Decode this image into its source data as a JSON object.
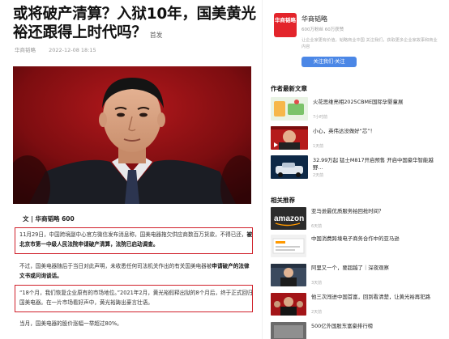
{
  "article": {
    "title": "或将破产清算？入狱10年，国美黄光裕还跟得上时代吗？",
    "title_tail": "首发",
    "author": "华商韬略",
    "date": "2022-12-08 18:15",
    "views": "阅读",
    "byline": "文 | 华商韬略 600",
    "p1_a": "11月29日，中国跨境副中心官方微信发布消息称，国美电器拖欠供应商数百万货款，不得已还，",
    "p1_b": "被北京市第一中级人民法院申请破产清算，法院已启动调查。",
    "p2_a": "不过，国美电器随后于当日对此声明，未收悉任何司法机关作出的有关国美电器被",
    "p2_b": "申请破产的法律文书或问询谈话。",
    "p3": "“18个月，我们恢复企业原有的市场地位。”2021年2月，黄光裕假释出狱的8个月后，终于正式回归国美电器。在一片市场看好声中，黄光裕踌出豪言壮语。",
    "p4": "当月，国美电器的股价涨幅一举超过80%。"
  },
  "author_card": {
    "logo_text": "华商韬略",
    "name": "华商韬略",
    "stats": "600万粉丝 60万获赞",
    "desc": "让企业家更有价值，韬略商业中国 关注我们，获取更多企业家故事和商业内容",
    "follow": "关注我们·关注"
  },
  "sidebar": {
    "latest_title": "作者最新文章",
    "related_title": "相关推荐",
    "latest": [
      {
        "title": "火花思维亮相2025CBME国际孕婴童展",
        "meta": "7小时前"
      },
      {
        "title": "小心，英伟达没做好“芯”！",
        "meta": "1天前"
      },
      {
        "title": "32.99万起 猛士M817开启预售 开启中国豪华智能越野…",
        "meta": "2天前"
      }
    ],
    "related": [
      {
        "title": "亚马逊最优质服务拍回抢时间？",
        "meta": "6天前"
      },
      {
        "title": "中国消费跨境电子商务合作中的亚马逊",
        "meta": ""
      },
      {
        "title": "阿里又一个，要超越了｜深夜观察",
        "meta": "3天前"
      },
      {
        "title": "他三次闯进中国首富，回到看清楚，让黄光裕再犯路",
        "meta": "2天前"
      },
      {
        "title": "500亿外国股东富豪排行榜",
        "meta": ""
      }
    ]
  },
  "colors": {
    "highlight_box": "#d0202a",
    "brand_red": "#e3242b",
    "follow_blue": "#4b87e6"
  }
}
